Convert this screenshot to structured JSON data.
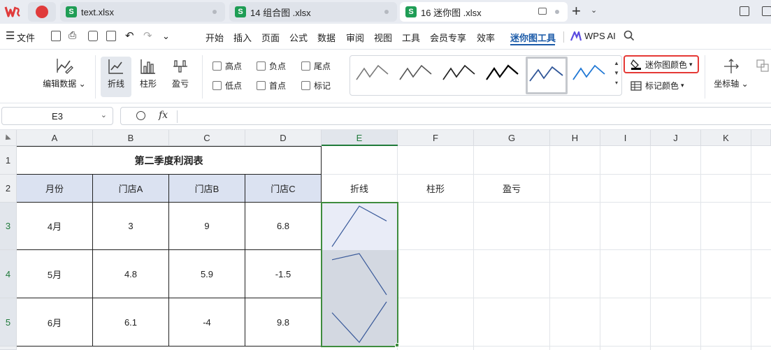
{
  "tabs": [
    {
      "label": "text.xlsx",
      "state": "inactive",
      "icon": "sheet-icon"
    },
    {
      "label": "14 组合图 .xlsx",
      "state": "inactive",
      "icon": "sheet-icon"
    },
    {
      "label": "16  迷你图 .xlsx",
      "state": "active",
      "icon": "sheet-icon"
    }
  ],
  "menu": {
    "file_label": "文件",
    "items": [
      "开始",
      "插入",
      "页面",
      "公式",
      "数据",
      "审阅",
      "视图",
      "工具",
      "会员专享",
      "效率",
      "迷你图工具"
    ],
    "active_item": "迷你图工具",
    "wps_ai": "WPS AI"
  },
  "ribbon": {
    "edit_data": "编辑数据",
    "types": [
      "折线",
      "柱形",
      "盈亏"
    ],
    "selected_type": "折线",
    "checkboxes": [
      {
        "label": "高点",
        "checked": false
      },
      {
        "label": "负点",
        "checked": false
      },
      {
        "label": "尾点",
        "checked": false
      },
      {
        "label": "低点",
        "checked": false
      },
      {
        "label": "首点",
        "checked": false
      },
      {
        "label": "标记",
        "checked": false
      }
    ],
    "sparkline_color": "迷你图颜色",
    "marker_color": "标记颜色",
    "axis": "坐标轴",
    "style_colors": [
      "#7a7a7a",
      "#555555",
      "#222222",
      "#000000",
      "#2f5597",
      "#1f77d4"
    ]
  },
  "formula_bar": {
    "name_box": "E3",
    "fx": "fx",
    "content": ""
  },
  "sheet": {
    "columns": [
      "A",
      "B",
      "C",
      "D",
      "E",
      "F",
      "G",
      "H",
      "I",
      "J",
      "K"
    ],
    "rows": [
      "1",
      "2",
      "3",
      "4",
      "5"
    ],
    "selected_column": "E",
    "selected_rows": [
      "3",
      "4",
      "5"
    ],
    "table_title": "第二季度利润表",
    "headers": [
      "月份",
      "门店A",
      "门店B",
      "门店C"
    ],
    "data": [
      [
        "4月",
        "3",
        "9",
        "6.8"
      ],
      [
        "5月",
        "4.8",
        "5.9",
        "-1.5"
      ],
      [
        "6月",
        "6.1",
        "-4",
        "9.8"
      ]
    ],
    "extra_labels": [
      "折线",
      "柱形",
      "盈亏"
    ],
    "sparkline_color": "#3a5a9a"
  }
}
